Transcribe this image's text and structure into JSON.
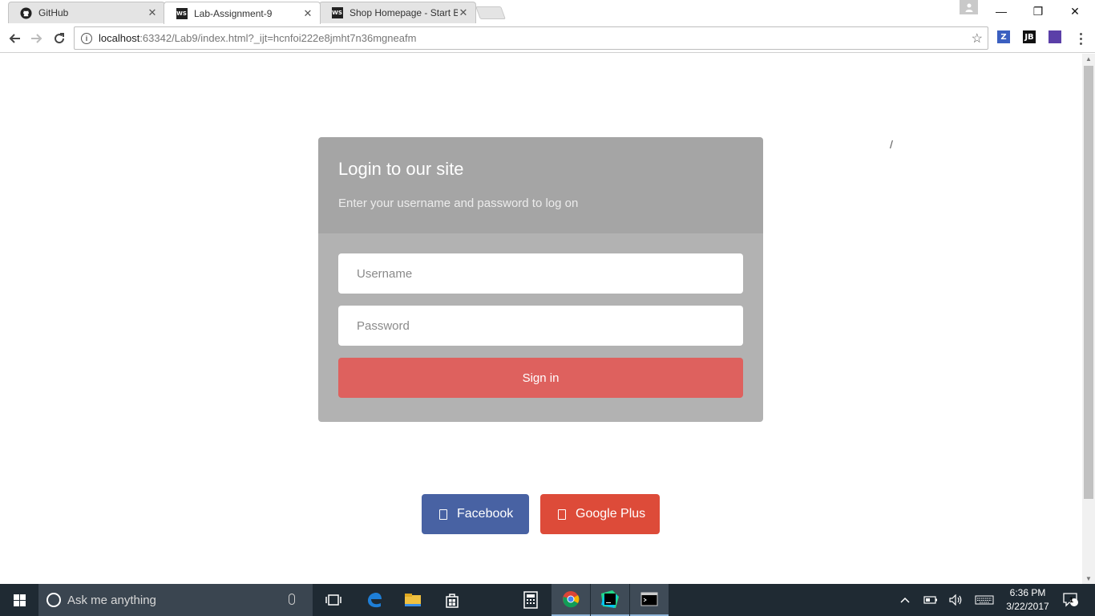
{
  "browser": {
    "tabs": [
      {
        "title": "GitHub",
        "favicon": "github-icon",
        "active": false
      },
      {
        "title": "Lab-Assignment-9",
        "favicon": "webstorm-icon",
        "active": true
      },
      {
        "title": "Shop Homepage - Start B",
        "favicon": "webstorm-icon",
        "active": false
      }
    ],
    "favicon_text": "WS",
    "close_glyph": "✕",
    "window_controls": {
      "minimize": "—",
      "restore": "❐",
      "close": "✕"
    },
    "url_host": "localhost",
    "url_rest": ":63342/Lab9/index.html?_ijt=hcnfoi222e8jmht7n36mgneafm",
    "extensions": [
      {
        "name": "z-extension-icon",
        "label": "Z",
        "color": "#3b5fc0"
      },
      {
        "name": "jetbrains-extension-icon",
        "label": "JB",
        "color": "#111111"
      },
      {
        "name": "purple-extension-icon",
        "label": "",
        "color": "#5b3fa8"
      }
    ]
  },
  "page": {
    "slash": "/",
    "login": {
      "title": "Login to our site",
      "subtitle": "Enter your username and password to log on",
      "username_placeholder": "Username",
      "password_placeholder": "Password",
      "signin_label": "Sign in"
    },
    "social": {
      "facebook_label": "Facebook",
      "google_label": "Google Plus"
    }
  },
  "taskbar": {
    "search_placeholder": "Ask me anything",
    "time": "6:36 PM",
    "date": "3/22/2017",
    "notification_count": "1"
  },
  "colors": {
    "login_header": "#a5a5a5",
    "login_body": "#b2b2b2",
    "signin": "#de615e",
    "facebook": "#4862a3",
    "google": "#dd4b39",
    "taskbar": "#1f2a33"
  }
}
